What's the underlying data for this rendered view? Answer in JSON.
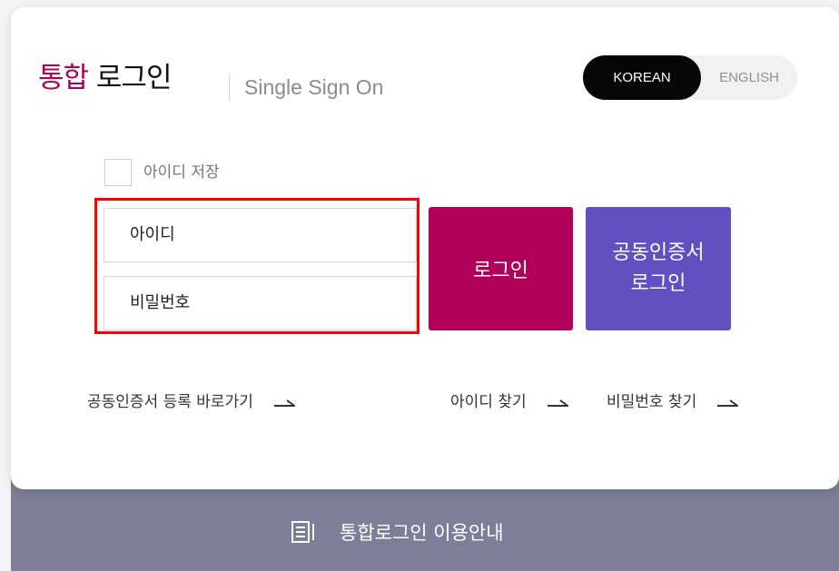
{
  "header": {
    "title_accent": "통합",
    "title_main": "로그인",
    "subtitle": "Single Sign On"
  },
  "language": {
    "korean_label": "KOREAN",
    "english_label": "ENGLISH",
    "selected": "KOREAN"
  },
  "login_form": {
    "save_id_label": "아이디 저장",
    "id_placeholder": "아이디",
    "password_placeholder": "비밀번호",
    "login_button": "로그인",
    "cert_login_line1": "공동인증서",
    "cert_login_line2": "로그인"
  },
  "links": {
    "cert_register": "공동인증서 등록 바로가기",
    "find_id": "아이디 찾기",
    "find_password": "비밀번호 찾기"
  },
  "footer": {
    "guide_label": "통합로그인 이용안내"
  },
  "colors": {
    "accent": "#b00055",
    "login_button": "#b1005a",
    "cert_button": "#6050c1",
    "footer_bar": "#7c7f97",
    "highlight": "#ff0000"
  }
}
